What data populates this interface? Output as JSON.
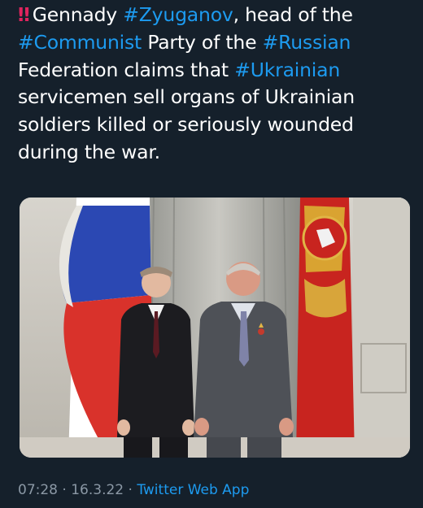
{
  "tweet": {
    "alert_icon": "‼",
    "lines": [
      [
        {
          "t": "Gennady ",
          "h": false
        },
        {
          "t": "#Zyuganov",
          "h": true
        },
        {
          "t": ", head of the",
          "h": false
        }
      ],
      [
        {
          "t": "#Communist",
          "h": true
        },
        {
          "t": " Party of the ",
          "h": false
        },
        {
          "t": "#Russian",
          "h": true
        }
      ],
      [
        {
          "t": "Federation claims that ",
          "h": false
        },
        {
          "t": "#Ukrainian",
          "h": true
        }
      ],
      [
        {
          "t": "servicemen sell organs of Ukrainian",
          "h": false
        }
      ],
      [
        {
          "t": "soldiers killed or seriously wounded",
          "h": false
        }
      ],
      [
        {
          "t": "during the war.",
          "h": false
        }
      ]
    ],
    "colors": {
      "hashtag": "#1d9bf0",
      "background": "#15202b",
      "text": "#ffffff",
      "meta": "#8b98a5",
      "alert": "#e0245e"
    }
  },
  "media": {
    "icon": "photo-two-men-flags"
  },
  "meta": {
    "time": "07:28",
    "date": "16.3.22",
    "separator": " · ",
    "source": "Twitter Web App"
  }
}
